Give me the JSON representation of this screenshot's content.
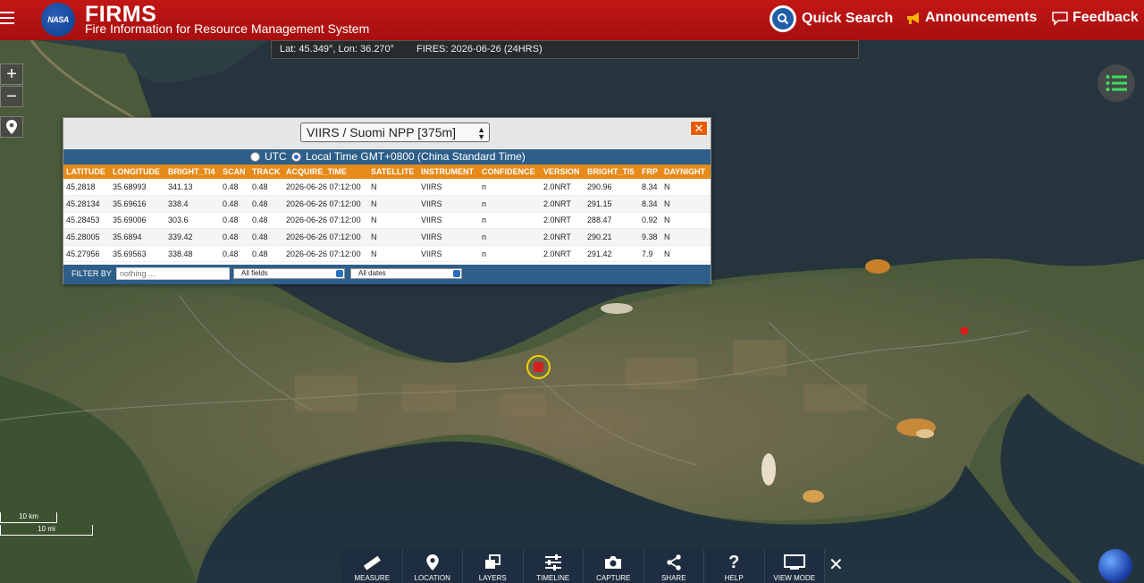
{
  "header": {
    "logo_text": "NASA",
    "title": "FIRMS",
    "subtitle": "Fire Information for Resource Management System",
    "quick_search": "Quick Search",
    "announcements": "Announcements",
    "feedback": "Feedback"
  },
  "coord_bar": {
    "location": "Lat: 45.349°, Lon: 36.270°",
    "fires": "FIRES: 2026-06-26 (24HRS)"
  },
  "map_controls": {
    "zoom_in": "+",
    "zoom_out": "−"
  },
  "panel": {
    "sensor": "VIIRS / Suomi NPP [375m]",
    "close": "✕",
    "tz_utc": "UTC",
    "tz_local": "Local Time GMT+0800 (China Standard Time)",
    "tz_selected": "local",
    "columns": [
      "LATITUDE",
      "LONGITUDE",
      "BRIGHT_TI4",
      "SCAN",
      "TRACK",
      "ACQUIRE_TIME",
      "SATELLITE",
      "INSTRUMENT",
      "CONFIDENCE",
      "VERSION",
      "BRIGHT_TI5",
      "FRP",
      "DAYNIGHT"
    ],
    "rows": [
      [
        "45.2818",
        "35.68993",
        "341.13",
        "0.48",
        "0.48",
        "2026-06-26 07:12:00",
        "N",
        "VIIRS",
        "n",
        "2.0NRT",
        "290.96",
        "8.34",
        "N"
      ],
      [
        "45.28134",
        "35.69616",
        "338.4",
        "0.48",
        "0.48",
        "2026-06-26 07:12:00",
        "N",
        "VIIRS",
        "n",
        "2.0NRT",
        "291.15",
        "8.34",
        "N"
      ],
      [
        "45.28453",
        "35.69006",
        "303.6",
        "0.48",
        "0.48",
        "2026-06-26 07:12:00",
        "N",
        "VIIRS",
        "n",
        "2.0NRT",
        "288.47",
        "0.92",
        "N"
      ],
      [
        "45.28005",
        "35.6894",
        "339.42",
        "0.48",
        "0.48",
        "2026-06-26 07:12:00",
        "N",
        "VIIRS",
        "n",
        "2.0NRT",
        "290.21",
        "9.38",
        "N"
      ],
      [
        "45.27956",
        "35.69563",
        "338.48",
        "0.48",
        "0.48",
        "2026-06-26 07:12:00",
        "N",
        "VIIRS",
        "n",
        "2.0NRT",
        "291.42",
        "7.9",
        "N"
      ]
    ],
    "filter_label": "FILTER BY",
    "filter_placeholder": "nothing ...",
    "field_select": "All fields",
    "date_select": "All dates"
  },
  "scale": {
    "km": "10 km",
    "mi": "10 mi"
  },
  "toolbar": {
    "items": [
      {
        "label": "MEASURE",
        "icon": "ruler-icon"
      },
      {
        "label": "LOCATION",
        "icon": "pin-icon"
      },
      {
        "label": "LAYERS",
        "icon": "layers-icon"
      },
      {
        "label": "TIMELINE",
        "icon": "sliders-icon"
      },
      {
        "label": "CAPTURE",
        "icon": "camera-icon"
      },
      {
        "label": "SHARE",
        "icon": "share-icon"
      },
      {
        "label": "HELP",
        "icon": "help-icon"
      },
      {
        "label": "VIEW MODE",
        "icon": "monitor-icon"
      }
    ],
    "close": "✕"
  },
  "colors": {
    "header_red": "#b81212",
    "table_header_orange": "#e68a1a",
    "panel_blue": "#2e5f8a",
    "marker_yellow": "#f2d200",
    "fire_red": "#d42020"
  }
}
